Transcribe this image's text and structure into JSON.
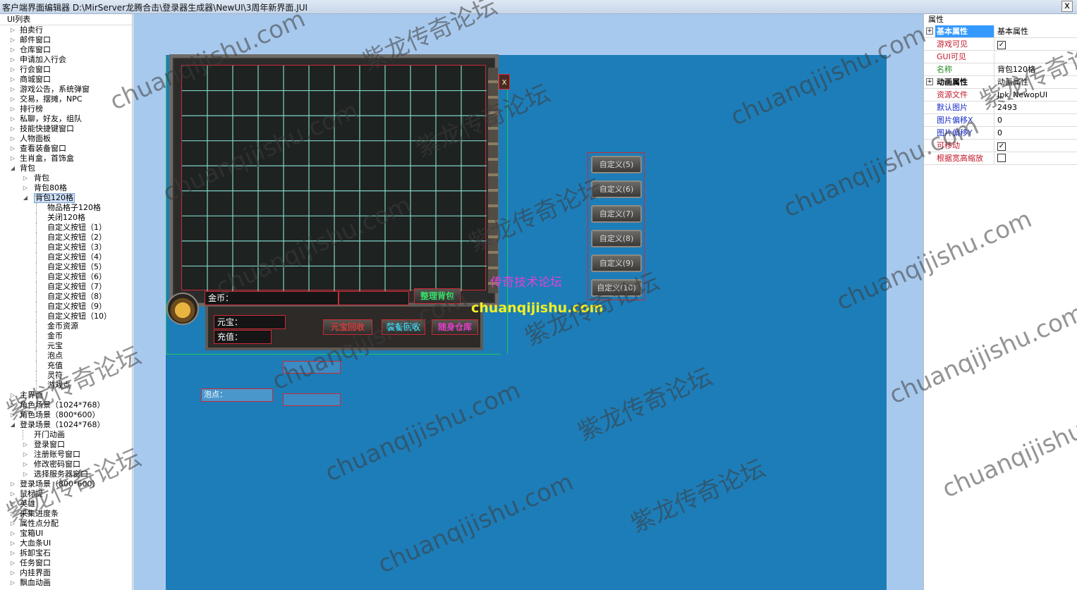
{
  "window": {
    "title": "客户端界面编辑器 D:\\MirServer龙腾合击\\登录器生成器\\NewUI\\3周年新界面.JUI",
    "close_label": "x"
  },
  "tree": {
    "header": "UI列表",
    "items": [
      {
        "label": "拍卖行",
        "level": 1,
        "expander": "▷"
      },
      {
        "label": "邮件窗口",
        "level": 1,
        "expander": "▷"
      },
      {
        "label": "仓库窗口",
        "level": 1,
        "expander": "▷"
      },
      {
        "label": "申请加入行会",
        "level": 1,
        "expander": "▷"
      },
      {
        "label": "行会窗口",
        "level": 1,
        "expander": "▷"
      },
      {
        "label": "商城窗口",
        "level": 1,
        "expander": "▷"
      },
      {
        "label": "游戏公告，系统弹窗",
        "level": 1,
        "expander": "▷"
      },
      {
        "label": "交易，摆摊，NPC",
        "level": 1,
        "expander": "▷"
      },
      {
        "label": "排行榜",
        "level": 1,
        "expander": "▷"
      },
      {
        "label": "私聊，好友，组队",
        "level": 1,
        "expander": "▷"
      },
      {
        "label": "技能快捷键窗口",
        "level": 1,
        "expander": "▷"
      },
      {
        "label": "人物面板",
        "level": 1,
        "expander": "▷"
      },
      {
        "label": "查看装备窗口",
        "level": 1,
        "expander": "▷"
      },
      {
        "label": "生肖盒，首饰盒",
        "level": 1,
        "expander": "▷"
      },
      {
        "label": "背包",
        "level": 1,
        "expander": "◢"
      },
      {
        "label": "背包",
        "level": 2,
        "expander": "▷"
      },
      {
        "label": "背包80格",
        "level": 2,
        "expander": "▷"
      },
      {
        "label": "背包120格",
        "level": 2,
        "expander": "◢",
        "selected": true
      },
      {
        "label": "物品格子120格",
        "level": 3,
        "expander": ""
      },
      {
        "label": "关闭120格",
        "level": 3,
        "expander": ""
      },
      {
        "label": "自定义按钮（1）",
        "level": 3,
        "expander": ""
      },
      {
        "label": "自定义按钮（2）",
        "level": 3,
        "expander": ""
      },
      {
        "label": "自定义按钮（3）",
        "level": 3,
        "expander": ""
      },
      {
        "label": "自定义按钮（4）",
        "level": 3,
        "expander": ""
      },
      {
        "label": "自定义按钮（5）",
        "level": 3,
        "expander": ""
      },
      {
        "label": "自定义按钮（6）",
        "level": 3,
        "expander": ""
      },
      {
        "label": "自定义按钮（7）",
        "level": 3,
        "expander": ""
      },
      {
        "label": "自定义按钮（8）",
        "level": 3,
        "expander": ""
      },
      {
        "label": "自定义按钮（9）",
        "level": 3,
        "expander": ""
      },
      {
        "label": "自定义按钮（10）",
        "level": 3,
        "expander": ""
      },
      {
        "label": "金币资源",
        "level": 3,
        "expander": ""
      },
      {
        "label": "金币",
        "level": 3,
        "expander": ""
      },
      {
        "label": "元宝",
        "level": 3,
        "expander": ""
      },
      {
        "label": "泡点",
        "level": 3,
        "expander": ""
      },
      {
        "label": "充值",
        "level": 3,
        "expander": ""
      },
      {
        "label": "灵符",
        "level": 3,
        "expander": ""
      },
      {
        "label": "游戏点",
        "level": 3,
        "expander": ""
      },
      {
        "label": "主界面",
        "level": 1,
        "expander": "▷"
      },
      {
        "label": "角色场景（1024*768）",
        "level": 1,
        "expander": "▷"
      },
      {
        "label": "角色场景（800*600）",
        "level": 1,
        "expander": "▷"
      },
      {
        "label": "登录场景（1024*768）",
        "level": 1,
        "expander": "◢"
      },
      {
        "label": "开门动画",
        "level": 2,
        "expander": ""
      },
      {
        "label": "登录窗口",
        "level": 2,
        "expander": "▷"
      },
      {
        "label": "注册账号窗口",
        "level": 2,
        "expander": "▷"
      },
      {
        "label": "修改密码窗口",
        "level": 2,
        "expander": "▷"
      },
      {
        "label": "选择服务器窗口",
        "level": 2,
        "expander": "▷"
      },
      {
        "label": "登录场景（800*600）",
        "level": 1,
        "expander": "▷"
      },
      {
        "label": "鼠标提",
        "level": 1,
        "expander": "▷"
      },
      {
        "label": "英雄",
        "level": 1,
        "expander": "▷"
      },
      {
        "label": "采集进度条",
        "level": 1,
        "expander": "▷"
      },
      {
        "label": "属性点分配",
        "level": 1,
        "expander": "▷"
      },
      {
        "label": "宝箱UI",
        "level": 1,
        "expander": "▷"
      },
      {
        "label": "大血条UI",
        "level": 1,
        "expander": "▷"
      },
      {
        "label": "拆卸宝石",
        "level": 1,
        "expander": "▷"
      },
      {
        "label": "任务窗口",
        "level": 1,
        "expander": "▷"
      },
      {
        "label": "内挂界面",
        "level": 1,
        "expander": "▷"
      },
      {
        "label": "飘血动画",
        "level": 1,
        "expander": "▷"
      }
    ]
  },
  "bag": {
    "close_glyph": "x",
    "gold_label": "金币：",
    "yuanbao_label": "元宝：",
    "chongzhi_label": "充值：",
    "paodian_label": "泡点：",
    "arrange_label": "整理背包",
    "recycle1_label": "元宝回收",
    "recycle2_label": "装备回收",
    "storage_label": "随身仓库",
    "grid_cols": 12,
    "grid_rows": 9
  },
  "custom_buttons": [
    "自定义(5)",
    "自定义(6)",
    "自定义(7)",
    "自定义(8)",
    "自定义(9)",
    "自定义(10)"
  ],
  "overlay": {
    "forum": "传奇技术论坛",
    "site": "chuanqijishu.com"
  },
  "props": {
    "header": "属性",
    "rows": [
      {
        "name": "基本属性",
        "value": "基本属性",
        "group": true,
        "toggle": "+",
        "selected": true,
        "name_color": "#ffffff"
      },
      {
        "name": "游戏可见",
        "check": true,
        "name_color": "#c0182a"
      },
      {
        "name": "GUI可见",
        "value": "",
        "name_color": "#c0182a"
      },
      {
        "name": "名称",
        "value": "背包120格",
        "name_color": "#1e8a1e"
      },
      {
        "name": "动画属性",
        "value": "动画属性",
        "group": true,
        "toggle": "+"
      },
      {
        "name": "资源文件",
        "value": "Jpk_NewopUI",
        "name_color": "#c0182a"
      },
      {
        "name": "默认图片",
        "value": "2493",
        "name_color": "#1a2ec8"
      },
      {
        "name": "图片偏移X",
        "value": "0",
        "name_color": "#1a2ec8"
      },
      {
        "name": "图片偏移Y",
        "value": "0",
        "name_color": "#1a2ec8"
      },
      {
        "name": "可移动",
        "check": true,
        "name_color": "#c0182a"
      },
      {
        "name": "根据宽高缩放",
        "check": false,
        "name_color": "#c0182a"
      }
    ]
  },
  "watermark": {
    "text_a": "chuanqijishu.com",
    "text_b": "紫龙传奇论坛"
  },
  "colors": {
    "canvas_bg": "#a8c9ee",
    "stage_bg": "#1d7db8",
    "selection_red": "#cc2a36",
    "grid_line": "#7fd3c7"
  }
}
